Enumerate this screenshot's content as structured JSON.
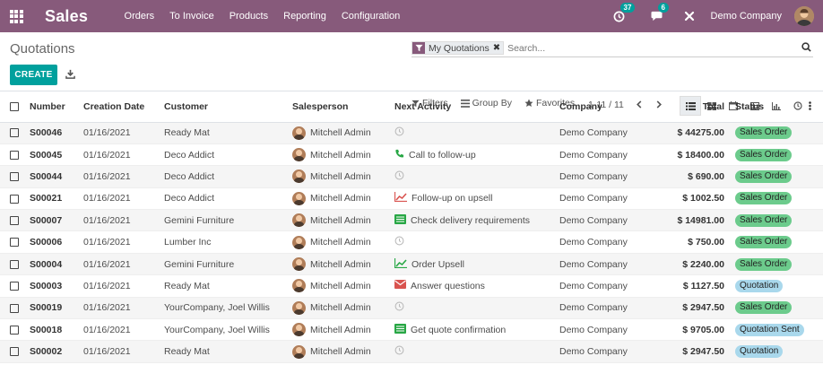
{
  "navbar": {
    "app_name": "Sales",
    "menu": [
      "Orders",
      "To Invoice",
      "Products",
      "Reporting",
      "Configuration"
    ],
    "activity_count": "37",
    "messages_count": "6",
    "company": "Demo Company"
  },
  "control_panel": {
    "title": "Quotations",
    "create_label": "CREATE",
    "facet_label": "My Quotations",
    "search_placeholder": "Search...",
    "filters_label": "Filters",
    "group_by_label": "Group By",
    "favorites_label": "Favorites",
    "pager": "1-11 / 11"
  },
  "table": {
    "headers": {
      "number": "Number",
      "date": "Creation Date",
      "customer": "Customer",
      "salesperson": "Salesperson",
      "activity": "Next Activity",
      "company": "Company",
      "total": "Total",
      "status": "Status"
    },
    "rows": [
      {
        "number": "S00046",
        "date": "01/16/2021",
        "customer": "Ready Mat",
        "salesperson": "Mitchell Admin",
        "activity_icon": "clock-icon",
        "activity": "",
        "company": "Demo Company",
        "total": "$ 44275.00",
        "status": "Sales Order",
        "status_kind": "so"
      },
      {
        "number": "S00045",
        "date": "01/16/2021",
        "customer": "Deco Addict",
        "salesperson": "Mitchell Admin",
        "activity_icon": "phone-icon",
        "activity": "Call to follow-up",
        "company": "Demo Company",
        "total": "$ 18400.00",
        "status": "Sales Order",
        "status_kind": "so"
      },
      {
        "number": "S00044",
        "date": "01/16/2021",
        "customer": "Deco Addict",
        "salesperson": "Mitchell Admin",
        "activity_icon": "clock-icon",
        "activity": "",
        "company": "Demo Company",
        "total": "$ 690.00",
        "status": "Sales Order",
        "status_kind": "so"
      },
      {
        "number": "S00021",
        "date": "01/16/2021",
        "customer": "Deco Addict",
        "salesperson": "Mitchell Admin",
        "activity_icon": "upsell-icon",
        "activity": "Follow-up on upsell",
        "company": "Demo Company",
        "total": "$ 1002.50",
        "status": "Sales Order",
        "status_kind": "so"
      },
      {
        "number": "S00007",
        "date": "01/16/2021",
        "customer": "Gemini Furniture",
        "salesperson": "Mitchell Admin",
        "activity_icon": "list-icon",
        "activity": "Check delivery requirements",
        "company": "Demo Company",
        "total": "$ 14981.00",
        "status": "Sales Order",
        "status_kind": "so"
      },
      {
        "number": "S00006",
        "date": "01/16/2021",
        "customer": "Lumber Inc",
        "salesperson": "Mitchell Admin",
        "activity_icon": "clock-icon",
        "activity": "",
        "company": "Demo Company",
        "total": "$ 750.00",
        "status": "Sales Order",
        "status_kind": "so"
      },
      {
        "number": "S00004",
        "date": "01/16/2021",
        "customer": "Gemini Furniture",
        "salesperson": "Mitchell Admin",
        "activity_icon": "trend-icon",
        "activity": "Order Upsell",
        "company": "Demo Company",
        "total": "$ 2240.00",
        "status": "Sales Order",
        "status_kind": "so"
      },
      {
        "number": "S00003",
        "date": "01/16/2021",
        "customer": "Ready Mat",
        "salesperson": "Mitchell Admin",
        "activity_icon": "email-icon",
        "activity": "Answer questions",
        "company": "Demo Company",
        "total": "$ 1127.50",
        "status": "Quotation",
        "status_kind": "q"
      },
      {
        "number": "S00019",
        "date": "01/16/2021",
        "customer": "YourCompany, Joel Willis",
        "salesperson": "Mitchell Admin",
        "activity_icon": "clock-icon",
        "activity": "",
        "company": "Demo Company",
        "total": "$ 2947.50",
        "status": "Sales Order",
        "status_kind": "so"
      },
      {
        "number": "S00018",
        "date": "01/16/2021",
        "customer": "YourCompany, Joel Willis",
        "salesperson": "Mitchell Admin",
        "activity_icon": "list-icon",
        "activity": "Get quote confirmation",
        "company": "Demo Company",
        "total": "$ 9705.00",
        "status": "Quotation Sent",
        "status_kind": "qs"
      },
      {
        "number": "S00002",
        "date": "01/16/2021",
        "customer": "Ready Mat",
        "salesperson": "Mitchell Admin",
        "activity_icon": "clock-icon",
        "activity": "",
        "company": "Demo Company",
        "total": "$ 2947.50",
        "status": "Quotation",
        "status_kind": "q"
      }
    ]
  },
  "colors": {
    "brand": "#875a7b",
    "accent": "#00a09d",
    "sales_order": "#6ccb8c",
    "quotation": "#a9d8ec"
  }
}
